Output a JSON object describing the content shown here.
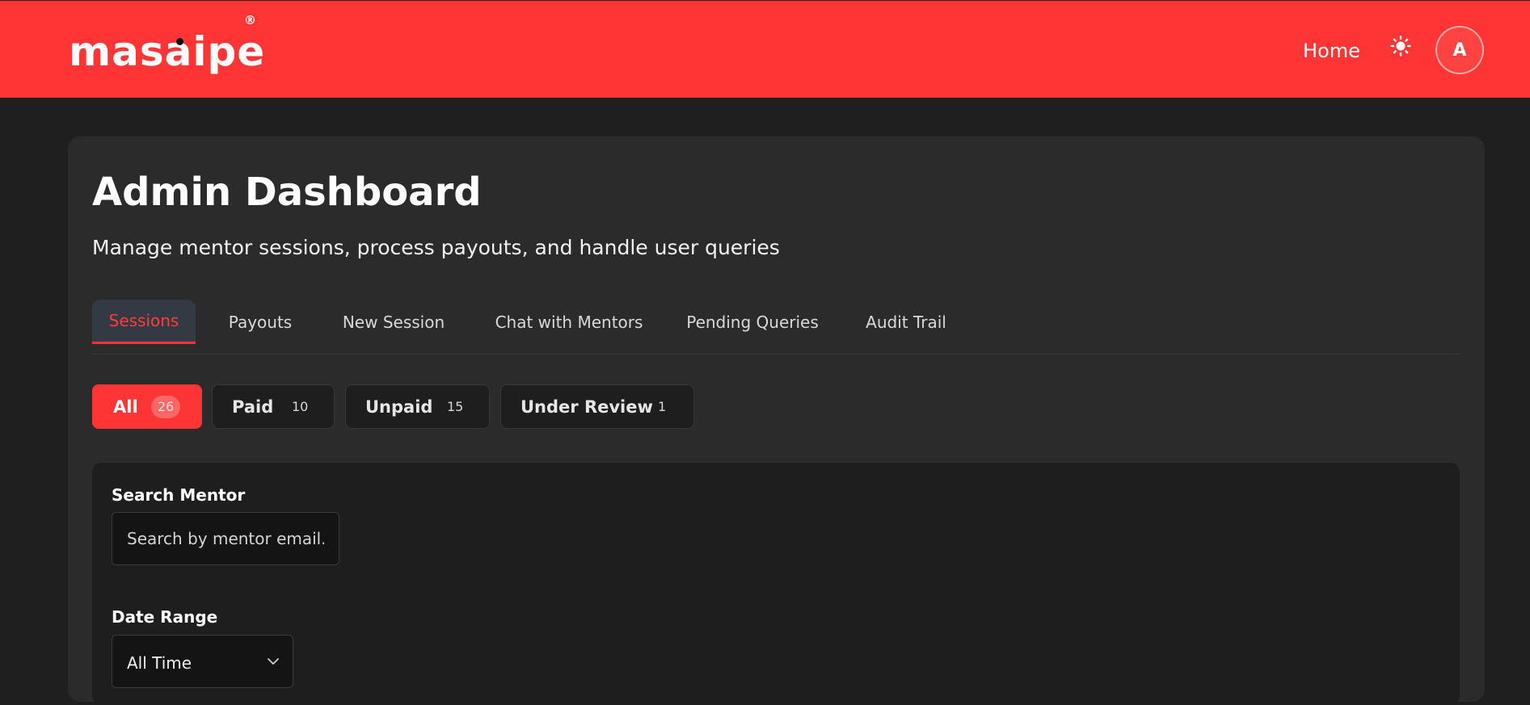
{
  "header": {
    "logo_text": "masaipe",
    "logo_reg": "®",
    "nav_home": "Home",
    "theme_icon": "sun-icon",
    "avatar_initial": "A",
    "brand_color": "#ff3434"
  },
  "main": {
    "title": "Admin Dashboard",
    "subtitle": "Manage mentor sessions, process payouts, and handle user queries",
    "tabs": [
      {
        "label": "Sessions",
        "active": true
      },
      {
        "label": "Payouts",
        "active": false
      },
      {
        "label": "New Session",
        "active": false
      },
      {
        "label": "Chat with Mentors",
        "active": false
      },
      {
        "label": "Pending Queries",
        "active": false
      },
      {
        "label": "Audit Trail",
        "active": false
      }
    ],
    "filters": [
      {
        "label": "All",
        "count": "26",
        "active": true
      },
      {
        "label": "Paid",
        "count": "10",
        "active": false
      },
      {
        "label": "Unpaid",
        "count": "15",
        "active": false
      },
      {
        "label": "Under Review",
        "count": "1",
        "active": false
      }
    ],
    "search": {
      "label": "Search Mentor",
      "placeholder": "Search by mentor email..."
    },
    "date_range": {
      "label": "Date Range",
      "value": "All Time",
      "icon": "chevron-down-icon"
    }
  }
}
